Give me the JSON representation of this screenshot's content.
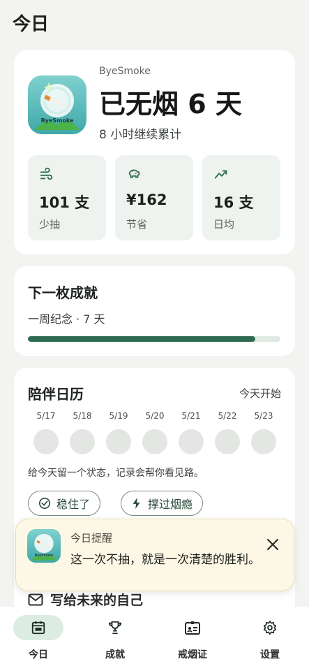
{
  "page_title": "今日",
  "hero": {
    "brand": "ByeSmoke",
    "icon_text": "ByeSmoke",
    "headline": "已无烟 6 天",
    "subtitle": "8 小时继续累计",
    "stats": [
      {
        "icon": "wind-icon",
        "value": "101 支",
        "label": "少抽"
      },
      {
        "icon": "piggy-bank-icon",
        "value": "¥162",
        "label": "节省"
      },
      {
        "icon": "trend-icon",
        "value": "16 支",
        "label": "日均"
      }
    ]
  },
  "achievement": {
    "title": "下一枚成就",
    "desc": "一周纪念 · 7 天",
    "progress": 0.9
  },
  "calendar": {
    "title": "陪伴日历",
    "link": "今天开始",
    "days": [
      "5/17",
      "5/18",
      "5/19",
      "5/20",
      "5/21",
      "5/22",
      "5/23"
    ],
    "hint": "给今天留一个状态，记录会帮你看见路。",
    "buttons": [
      "稳住了",
      "撑过烟瘾"
    ],
    "peek": "写给未来的自己"
  },
  "toast": {
    "title": "今日提醒",
    "message": "这一次不抽，就是一次清楚的胜利。"
  },
  "nav": [
    {
      "label": "今日",
      "icon": "calendar-icon",
      "active": true
    },
    {
      "label": "成就",
      "icon": "trophy-icon",
      "active": false
    },
    {
      "label": "戒烟证",
      "icon": "badge-icon",
      "active": false
    },
    {
      "label": "设置",
      "icon": "gear-icon",
      "active": false
    }
  ],
  "colors": {
    "accent": "#2f6b52",
    "toast_bg": "#fdf8e6"
  }
}
